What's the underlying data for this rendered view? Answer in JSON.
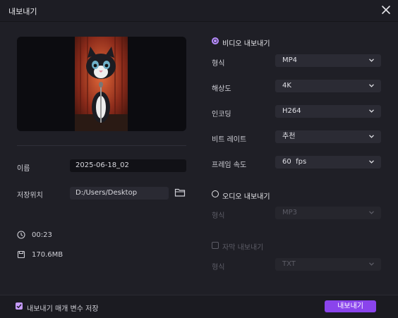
{
  "window": {
    "title": "내보내기"
  },
  "left": {
    "name_label": "이름",
    "name_value": "2025-06-18_02",
    "save_location_label": "저장위치",
    "save_location_value": "D:/Users/Desktop",
    "duration": "00:23",
    "file_size": "170.6MB"
  },
  "video": {
    "section_label": "비디오 내보내기",
    "selected": true,
    "rows": [
      {
        "label": "형식",
        "value": "MP4"
      },
      {
        "label": "해상도",
        "value": "4K"
      },
      {
        "label": "인코딩",
        "value": "H264"
      },
      {
        "label": "비트 레이트",
        "value": "추천"
      },
      {
        "label": "프레임 속도",
        "value": "60  fps"
      }
    ]
  },
  "audio": {
    "section_label": "오디오 내보내기",
    "selected": false,
    "format_label": "형식",
    "format_value": "MP3"
  },
  "subtitle": {
    "checkbox_label": "자막 내보내기",
    "checked": false,
    "format_label": "형식",
    "format_value": "TXT"
  },
  "footer": {
    "save_params_label": "내보내기 매개 변수 저장",
    "save_params_checked": true,
    "export_button": "내보내기"
  },
  "colors": {
    "accent": "#8a44ec",
    "radio_accent": "#b78cff",
    "background": "#1f1f26"
  }
}
